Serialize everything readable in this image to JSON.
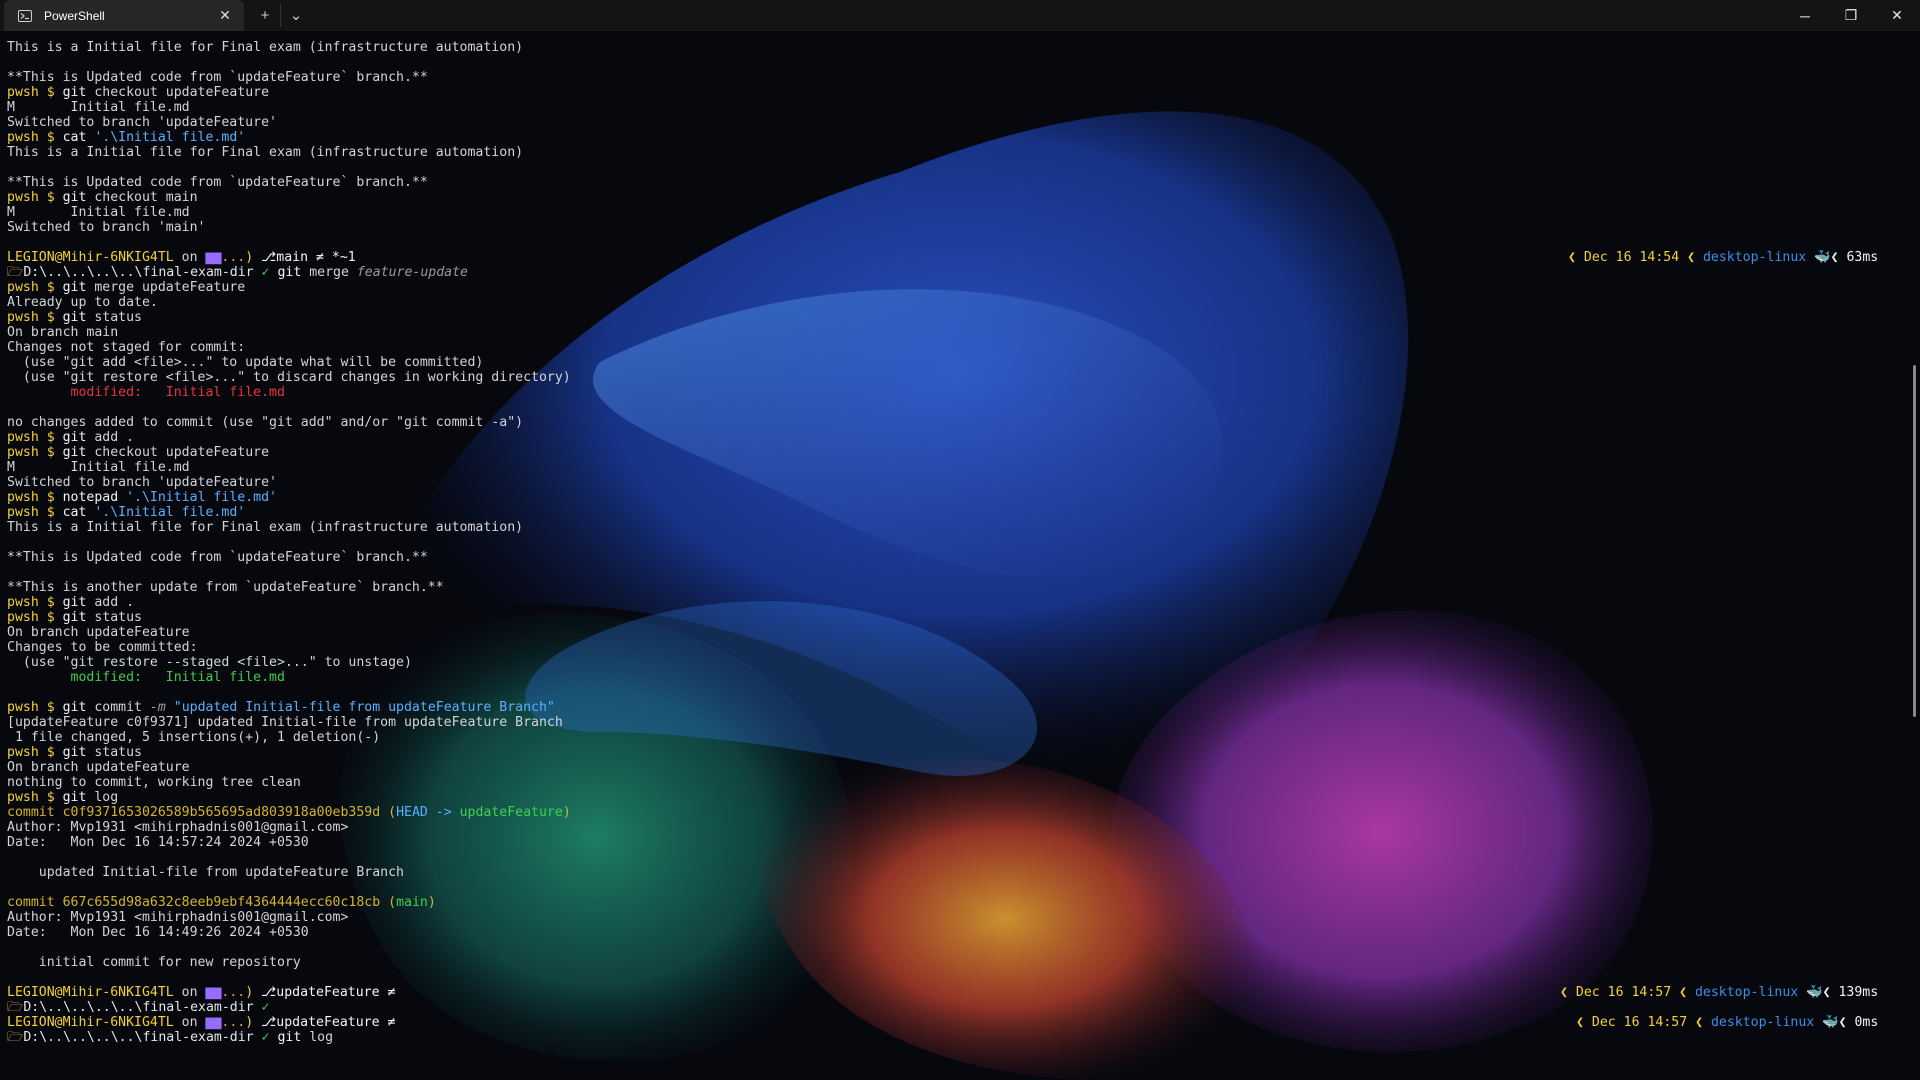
{
  "window": {
    "tab_title": "PowerShell",
    "tab_icon": "powershell-icon",
    "tab_close": "✕",
    "new_tab": "+",
    "dropdown": "⌄",
    "minimize": "─",
    "maximize": "❐",
    "close": "✕"
  },
  "colors": {
    "prompt_user": "#f2d03a",
    "pwsh_prompt": "#f2d03a",
    "string": "#5ab0ff",
    "modified_unstaged": "#e8343a",
    "modified_staged": "#3fcc4a",
    "commit_hash": "#d6b42a",
    "right_prompt": "#f2d03a",
    "host": "#3b8eea"
  },
  "lines": [
    [
      {
        "t": "This is a Initial file for Final exam (infrastructure automation)",
        "c": "gray"
      }
    ],
    [],
    [
      {
        "t": "**This is Updated code from `updateFeature` branch.**",
        "c": "gray"
      }
    ],
    [
      {
        "t": "pwsh $ ",
        "c": "yellow"
      },
      {
        "t": "git ",
        "c": "white"
      },
      {
        "t": "checkout updateFeature",
        "c": "gray"
      }
    ],
    [
      {
        "t": "M       Initial file.md",
        "c": "gray"
      }
    ],
    [
      {
        "t": "Switched to branch 'updateFeature'",
        "c": "gray"
      }
    ],
    [
      {
        "t": "pwsh $ ",
        "c": "yellow"
      },
      {
        "t": "cat ",
        "c": "white"
      },
      {
        "t": "'.\\Initial file.md'",
        "c": "cyan"
      }
    ],
    [
      {
        "t": "This is a Initial file for Final exam (infrastructure automation)",
        "c": "gray"
      }
    ],
    [],
    [
      {
        "t": "**This is Updated code from `updateFeature` branch.**",
        "c": "gray"
      }
    ],
    [
      {
        "t": "pwsh $ ",
        "c": "yellow"
      },
      {
        "t": "git ",
        "c": "white"
      },
      {
        "t": "checkout main",
        "c": "gray"
      }
    ],
    [
      {
        "t": "M       Initial file.md",
        "c": "gray"
      }
    ],
    [
      {
        "t": "Switched to branch 'main'",
        "c": "gray"
      }
    ],
    [],
    {
      "segs": [
        {
          "t": "LEGION@Mihir-6NKIG4TL ",
          "c": "yellow"
        },
        {
          "t": "on ",
          "c": "gray"
        },
        {
          "t": "▆▆",
          "c": "purple"
        },
        {
          "t": "...",
          "c": "amber"
        },
        {
          "t": ") ",
          "c": "yellow"
        },
        {
          "t": "⎇main ≠ *~1",
          "c": "white"
        }
      ],
      "right": [
        {
          "t": "❮ Dec 16 14:54 ❮ ",
          "c": "yellow"
        },
        {
          "t": "desktop-linux ",
          "c": "blue"
        },
        {
          "t": "🐳",
          "c": "blue"
        },
        {
          "t": "❮ 63ms",
          "c": "white"
        }
      ]
    },
    [
      {
        "t": "🗁",
        "c": "yellow"
      },
      {
        "t": "D:\\..\\..\\..\\..\\final-exam-dir ",
        "c": "path"
      },
      {
        "t": "✓ ",
        "c": "tick"
      },
      {
        "t": "git ",
        "c": "white"
      },
      {
        "t": "merge ",
        "c": "gray"
      },
      {
        "t": "feature-update",
        "c": "dim"
      }
    ],
    [
      {
        "t": "pwsh $ ",
        "c": "yellow"
      },
      {
        "t": "git ",
        "c": "white"
      },
      {
        "t": "merge updateFeature",
        "c": "gray"
      }
    ],
    [
      {
        "t": "Already up to date.",
        "c": "gray"
      }
    ],
    [
      {
        "t": "pwsh $ ",
        "c": "yellow"
      },
      {
        "t": "git ",
        "c": "white"
      },
      {
        "t": "status",
        "c": "gray"
      }
    ],
    [
      {
        "t": "On branch main",
        "c": "gray"
      }
    ],
    [
      {
        "t": "Changes not staged for commit:",
        "c": "gray"
      }
    ],
    [
      {
        "t": "  (use \"git add <file>...\" to update what will be committed)",
        "c": "gray"
      }
    ],
    [
      {
        "t": "  (use \"git restore <file>...\" to discard changes in working directory)",
        "c": "gray"
      }
    ],
    [
      {
        "t": "        modified:   Initial file.md",
        "c": "red"
      }
    ],
    [],
    [
      {
        "t": "no changes added to commit (use \"git add\" and/or \"git commit -a\")",
        "c": "gray"
      }
    ],
    [
      {
        "t": "pwsh $ ",
        "c": "yellow"
      },
      {
        "t": "git ",
        "c": "white"
      },
      {
        "t": "add .",
        "c": "gray"
      }
    ],
    [
      {
        "t": "pwsh $ ",
        "c": "yellow"
      },
      {
        "t": "git ",
        "c": "white"
      },
      {
        "t": "checkout updateFeature",
        "c": "gray"
      }
    ],
    [
      {
        "t": "M       Initial file.md",
        "c": "gray"
      }
    ],
    [
      {
        "t": "Switched to branch 'updateFeature'",
        "c": "gray"
      }
    ],
    [
      {
        "t": "pwsh $ ",
        "c": "yellow"
      },
      {
        "t": "notepad ",
        "c": "white"
      },
      {
        "t": "'.\\Initial file.md'",
        "c": "cyan"
      }
    ],
    [
      {
        "t": "pwsh $ ",
        "c": "yellow"
      },
      {
        "t": "cat ",
        "c": "white"
      },
      {
        "t": "'.\\Initial file.md'",
        "c": "cyan"
      }
    ],
    [
      {
        "t": "This is a Initial file for Final exam (infrastructure automation)",
        "c": "gray"
      }
    ],
    [],
    [
      {
        "t": "**This is Updated code from `updateFeature` branch.**",
        "c": "gray"
      }
    ],
    [],
    [
      {
        "t": "**This is another update from `updateFeature` branch.**",
        "c": "gray"
      }
    ],
    [
      {
        "t": "pwsh $ ",
        "c": "yellow"
      },
      {
        "t": "git ",
        "c": "white"
      },
      {
        "t": "add .",
        "c": "gray"
      }
    ],
    [
      {
        "t": "pwsh $ ",
        "c": "yellow"
      },
      {
        "t": "git ",
        "c": "white"
      },
      {
        "t": "status",
        "c": "gray"
      }
    ],
    [
      {
        "t": "On branch updateFeature",
        "c": "gray"
      }
    ],
    [
      {
        "t": "Changes to be committed:",
        "c": "gray"
      }
    ],
    [
      {
        "t": "  (use \"git restore --staged <file>...\" to unstage)",
        "c": "gray"
      }
    ],
    [
      {
        "t": "        modified:   Initial file.md",
        "c": "green"
      }
    ],
    [],
    [
      {
        "t": "pwsh $ ",
        "c": "yellow"
      },
      {
        "t": "git ",
        "c": "white"
      },
      {
        "t": "commit ",
        "c": "gray"
      },
      {
        "t": "-m ",
        "c": "dim"
      },
      {
        "t": "\"updated Initial-file from updateFeature Branch\"",
        "c": "cyan"
      }
    ],
    [
      {
        "t": "[updateFeature c0f9371] updated Initial-file from updateFeature Branch",
        "c": "gray"
      }
    ],
    [
      {
        "t": " 1 file changed, 5 insertions(+), 1 deletion(-)",
        "c": "gray"
      }
    ],
    [
      {
        "t": "pwsh $ ",
        "c": "yellow"
      },
      {
        "t": "git ",
        "c": "white"
      },
      {
        "t": "status",
        "c": "gray"
      }
    ],
    [
      {
        "t": "On branch updateFeature",
        "c": "gray"
      }
    ],
    [
      {
        "t": "nothing to commit, working tree clean",
        "c": "gray"
      }
    ],
    [
      {
        "t": "pwsh $ ",
        "c": "yellow"
      },
      {
        "t": "git ",
        "c": "white"
      },
      {
        "t": "log",
        "c": "gray"
      }
    ],
    [
      {
        "t": "commit c0f9371653026589b565695ad803918a00eb359d ",
        "c": "gold"
      },
      {
        "t": "(",
        "c": "gold"
      },
      {
        "t": "HEAD -> ",
        "c": "cyan"
      },
      {
        "t": "updateFeature",
        "c": "lime"
      },
      {
        "t": ")",
        "c": "gold"
      }
    ],
    [
      {
        "t": "Author: Mvp1931 <mihirphadnis001@gmail.com>",
        "c": "gray"
      }
    ],
    [
      {
        "t": "Date:   Mon Dec 16 14:57:24 2024 +0530",
        "c": "gray"
      }
    ],
    [],
    [
      {
        "t": "    updated Initial-file from updateFeature Branch",
        "c": "gray"
      }
    ],
    [],
    [
      {
        "t": "commit 667c655d98a632c8eeb9ebf4364444ecc60c18cb ",
        "c": "gold"
      },
      {
        "t": "(",
        "c": "gold"
      },
      {
        "t": "main",
        "c": "lime"
      },
      {
        "t": ")",
        "c": "gold"
      }
    ],
    [
      {
        "t": "Author: Mvp1931 <mihirphadnis001@gmail.com>",
        "c": "gray"
      }
    ],
    [
      {
        "t": "Date:   Mon Dec 16 14:49:26 2024 +0530",
        "c": "gray"
      }
    ],
    [],
    [
      {
        "t": "    initial commit for new repository",
        "c": "gray"
      }
    ],
    [],
    {
      "segs": [
        {
          "t": "LEGION@Mihir-6NKIG4TL ",
          "c": "yellow"
        },
        {
          "t": "on ",
          "c": "gray"
        },
        {
          "t": "▆▆",
          "c": "purple"
        },
        {
          "t": "...",
          "c": "amber"
        },
        {
          "t": ") ",
          "c": "yellow"
        },
        {
          "t": "⎇updateFeature ≠",
          "c": "white"
        }
      ],
      "right": [
        {
          "t": "❮ Dec 16 14:57 ❮ ",
          "c": "yellow"
        },
        {
          "t": "desktop-linux ",
          "c": "blue"
        },
        {
          "t": "🐳",
          "c": "blue"
        },
        {
          "t": "❮ 139ms",
          "c": "white"
        }
      ]
    },
    [
      {
        "t": "🗁",
        "c": "yellow"
      },
      {
        "t": "D:\\..\\..\\..\\..\\final-exam-dir ",
        "c": "path"
      },
      {
        "t": "✓",
        "c": "tick"
      }
    ],
    {
      "segs": [
        {
          "t": "LEGION@Mihir-6NKIG4TL ",
          "c": "yellow"
        },
        {
          "t": "on ",
          "c": "gray"
        },
        {
          "t": "▆▆",
          "c": "purple"
        },
        {
          "t": "...",
          "c": "amber"
        },
        {
          "t": ") ",
          "c": "yellow"
        },
        {
          "t": "⎇updateFeature ≠",
          "c": "white"
        }
      ],
      "right": [
        {
          "t": "❮ Dec 16 14:57 ❮ ",
          "c": "yellow"
        },
        {
          "t": "desktop-linux ",
          "c": "blue"
        },
        {
          "t": "🐳",
          "c": "blue"
        },
        {
          "t": "❮ 0ms",
          "c": "white"
        }
      ]
    },
    [
      {
        "t": "🗁",
        "c": "yellow"
      },
      {
        "t": "D:\\..\\..\\..\\..\\final-exam-dir ",
        "c": "path"
      },
      {
        "t": "✓ ",
        "c": "tick"
      },
      {
        "t": "git ",
        "c": "white"
      },
      {
        "t": "log",
        "c": "gray"
      }
    ]
  ]
}
